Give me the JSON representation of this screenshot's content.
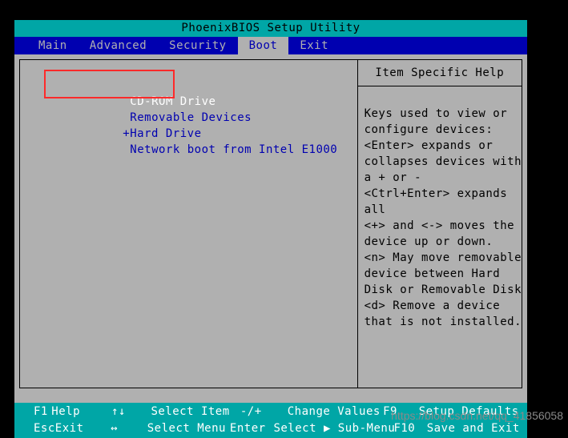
{
  "window": {
    "title": "PhoenixBIOS Setup Utility"
  },
  "menu": {
    "tabs": [
      {
        "label": "Main",
        "active": false
      },
      {
        "label": "Advanced",
        "active": false
      },
      {
        "label": "Security",
        "active": false
      },
      {
        "label": "Boot",
        "active": true
      },
      {
        "label": "Exit",
        "active": false
      }
    ]
  },
  "boot_list": {
    "items": [
      {
        "label": "CD-ROM Drive",
        "prefix": "",
        "selected": true
      },
      {
        "label": "Removable Devices",
        "prefix": "",
        "selected": false
      },
      {
        "label": "Hard Drive",
        "prefix": "+",
        "selected": false
      },
      {
        "label": "Network boot from Intel E1000",
        "prefix": "",
        "selected": false
      }
    ],
    "annotation_color": "#ff2a2a"
  },
  "help": {
    "title": "Item Specific Help",
    "lines": [
      "Keys used to view or",
      "configure devices:",
      "<Enter> expands or",
      "collapses devices with",
      "a + or -",
      "<Ctrl+Enter> expands",
      "all",
      "<+> and <-> moves the",
      "device up or down.",
      "<n> May move removable",
      "device between Hard",
      "Disk or Removable Disk",
      "<d> Remove a device",
      "that is not installed."
    ]
  },
  "footer": {
    "row1": {
      "key1": "F1",
      "action1": "Help",
      "arrow": "↑↓",
      "select": "Select Item",
      "key2": "-/+",
      "action2": "Change Values",
      "key3": "F9",
      "action3": "Setup Defaults"
    },
    "row2": {
      "key1": "Esc",
      "action1": "Exit",
      "arrow": "↔",
      "select": "Select Menu",
      "key2": "Enter",
      "action2": "Select ▶ Sub-Menu",
      "key3": "F10",
      "action3": "Save and Exit"
    }
  },
  "watermark": {
    "text": "https://blog.csdn.net/qq_41856058"
  },
  "colors": {
    "title_bar": "#00a6a6",
    "menu_bar": "#0000b0",
    "panel": "#b0b0b0",
    "footer": "#00a6a6",
    "item_text": "#0000b0",
    "selected_text": "#ffffff"
  }
}
